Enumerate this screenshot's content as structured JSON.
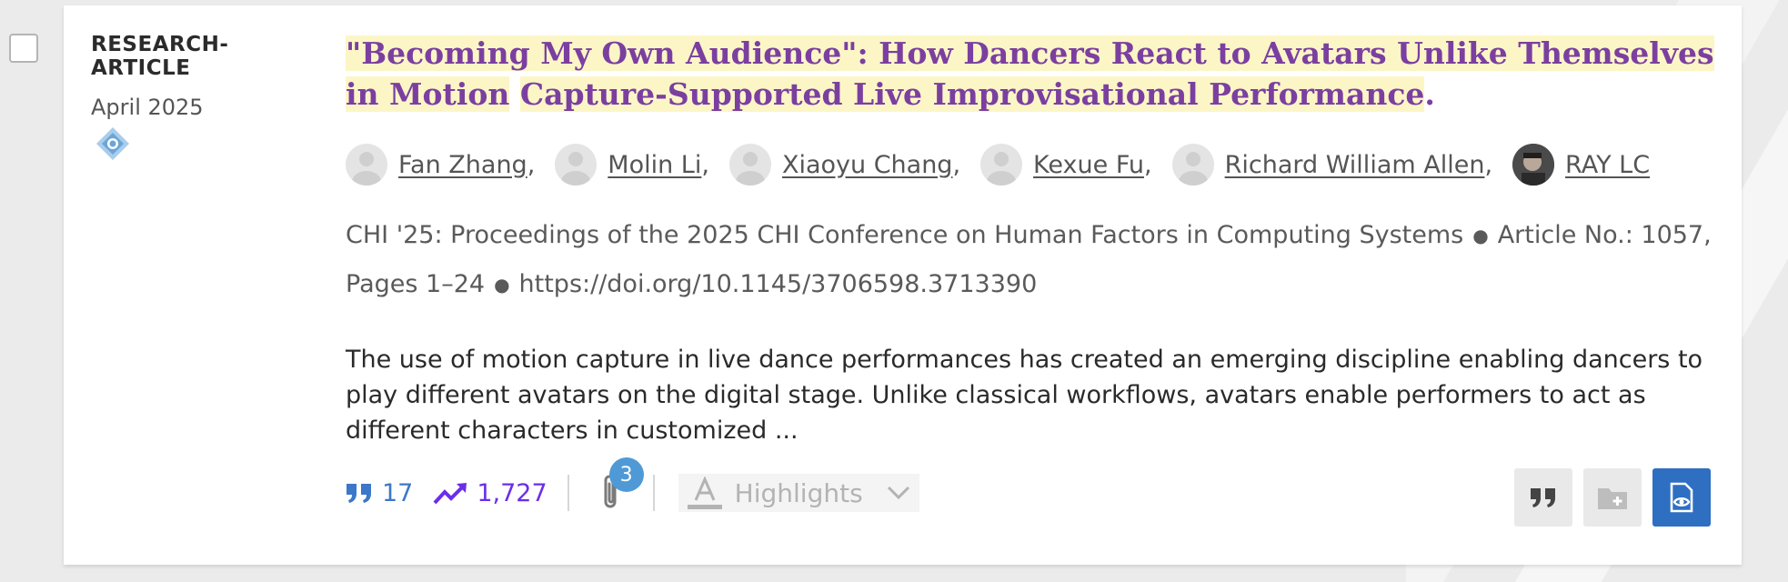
{
  "checkbox": {
    "checked": false
  },
  "article": {
    "type": "RESEARCH-ARTICLE",
    "date": "April 2025",
    "venue_logo_icon": "acm-diamond-icon",
    "title_parts": [
      "\"Becoming My Own Audience\": How Dancers React to Avatars Unlike Themselves in Motion",
      "Capture-Supported Live Improvisational Performance"
    ],
    "title_end": ".",
    "authors": [
      {
        "name": "Fan Zhang"
      },
      {
        "name": "Molin Li"
      },
      {
        "name": "Xiaoyu Chang"
      },
      {
        "name": "Kexue Fu"
      },
      {
        "name": "Richard William Allen"
      },
      {
        "name": "RAY LC"
      }
    ],
    "author_separator": ",",
    "venue_line": "CHI '25: Proceedings of the 2025 CHI Conference on Human Factors in Computing Systems",
    "article_no": "Article No.: 1057, Pages 1–24",
    "doi": "https://doi.org/10.1145/3706598.3713390",
    "abstract": "The use of motion capture in live dance performances has created an emerging discipline enabling dancers to play different avatars on the digital stage. Unlike classical workflows, avatars enable performers to act as different characters in customized ..."
  },
  "metrics": {
    "citations": "17",
    "downloads": "1,727",
    "supplemental_count": "3"
  },
  "highlights": {
    "label": "Highlights"
  },
  "colors": {
    "title": "#7b3fa0",
    "title_highlight": "#fcf6c7",
    "citations": "#3c77c9",
    "downloads": "#6a2ee8",
    "primary_button": "#2e6fc1",
    "badge": "#4f9ad6"
  },
  "icons": {
    "citations": "quote-icon",
    "downloads": "trending-up-icon",
    "supplemental": "paperclip-icon",
    "highlights": "text-highlight-icon",
    "dropdown": "chevron-down-icon",
    "cite_action": "quote-icon",
    "save_action": "folder-plus-icon",
    "view_action": "file-eye-icon"
  }
}
